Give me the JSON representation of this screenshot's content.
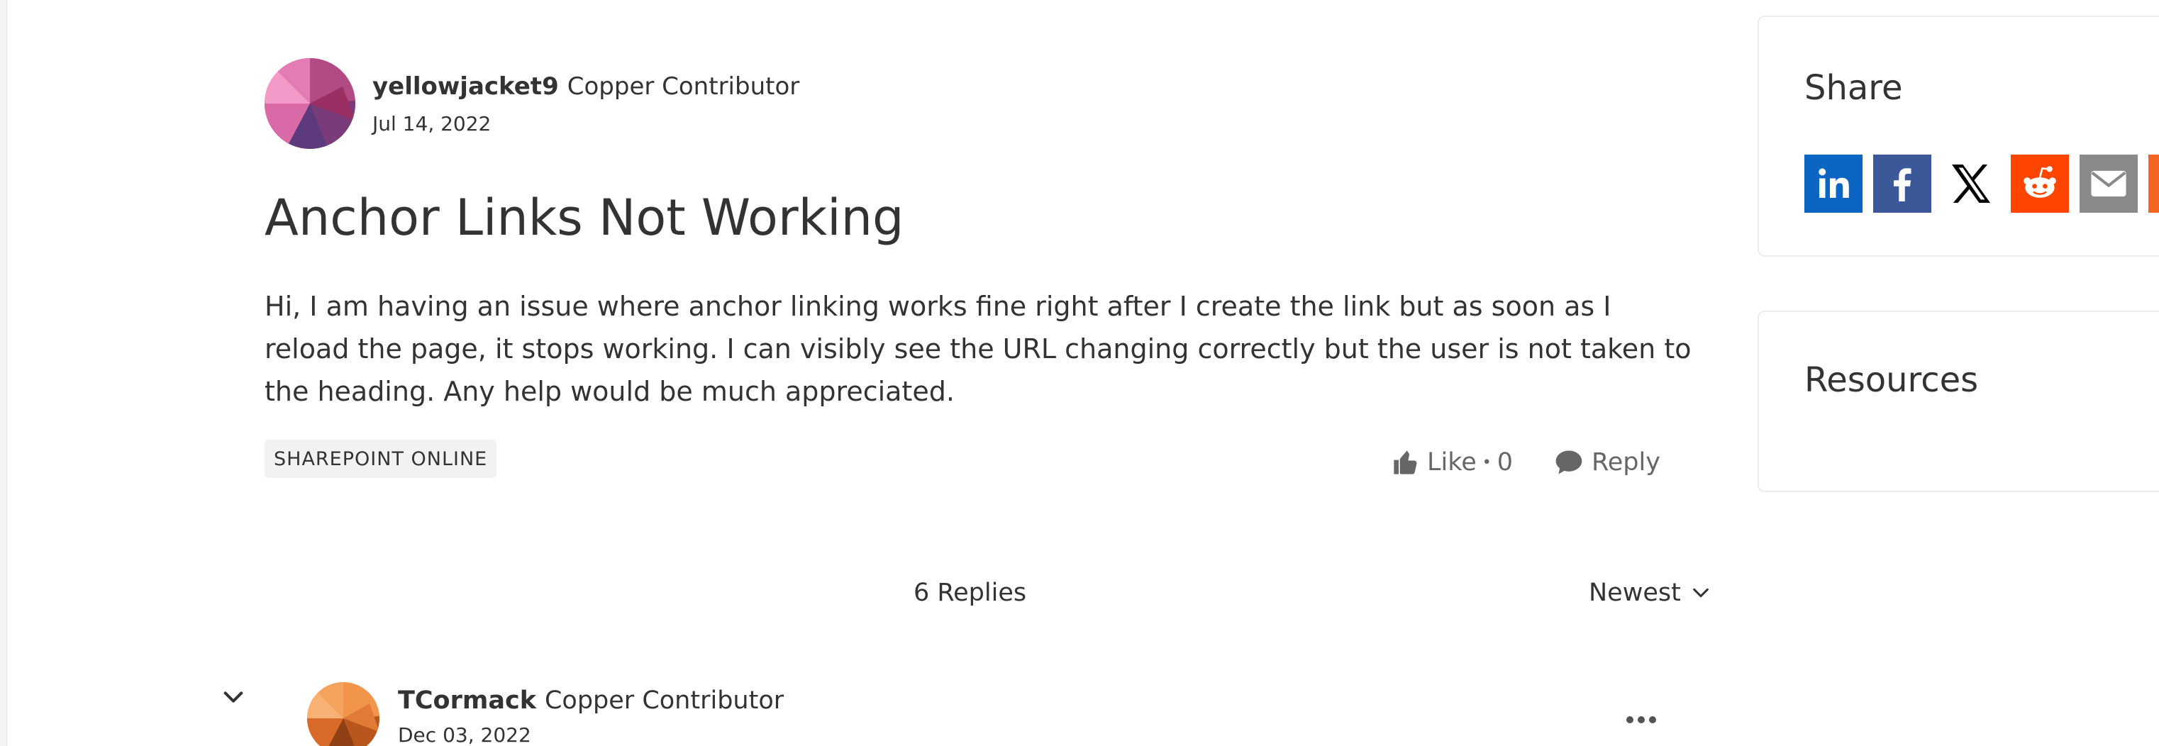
{
  "post": {
    "author_name": "yellowjacket9",
    "author_rank": "Copper Contributor",
    "date": "Jul 14, 2022",
    "title": "Anchor Links Not Working",
    "body": "Hi, I am having an issue where anchor linking works fine right after I create the link but as soon as I reload the page, it stops working. I can visibly see the URL changing correctly but the user is not taken to the heading. Any help would be much appreciated.",
    "tag": "SHAREPOINT ONLINE",
    "like_label": "Like",
    "like_separator": "•",
    "like_count": "0",
    "reply_label": "Reply"
  },
  "replies": {
    "count_label": "6 Replies",
    "sort_label": "Newest",
    "first": {
      "author_name": "TCormack",
      "author_rank": "Copper Contributor",
      "date": "Dec 03, 2022"
    }
  },
  "sidebar": {
    "share_title": "Share",
    "share_icons": [
      "linkedin-icon",
      "facebook-icon",
      "x-icon",
      "reddit-icon",
      "email-icon",
      "rss-icon"
    ],
    "resources_title": "Resources"
  },
  "colors": {
    "linkedin": "#0a66c2",
    "facebook": "#3b5998",
    "x": "#000000",
    "reddit": "#ff4500",
    "email": "#8a8a8a",
    "rss": "#f26522"
  }
}
